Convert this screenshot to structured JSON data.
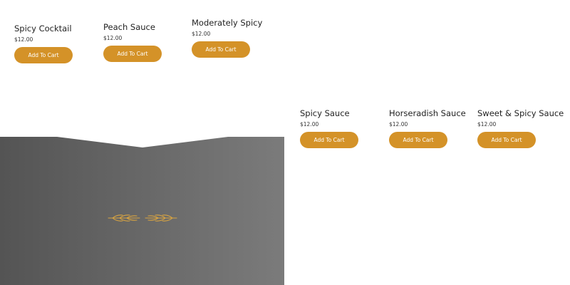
{
  "colors": {
    "accent": "#d49228",
    "banner_dark": "#555555",
    "banner_light": "#7a7a7a",
    "ornament": "#d9a441"
  },
  "products_top": [
    {
      "name": "Spicy Cocktail",
      "price": "$12.00",
      "button": "Add To Cart"
    },
    {
      "name": "Peach Sauce",
      "price": "$12.00",
      "button": "Add To Cart"
    },
    {
      "name": "Moderately Spicy",
      "price": "$12.00",
      "button": "Add To Cart"
    }
  ],
  "products_bottom": [
    {
      "name": "Spicy Sauce",
      "price": "$12.00",
      "button": "Add To Cart"
    },
    {
      "name": "Horseradish Sauce",
      "price": "$12.00",
      "button": "Add To Cart"
    },
    {
      "name": "Sweet & Spicy Sauce",
      "price": "$12.00",
      "button": "Add To Cart"
    }
  ],
  "banner": {
    "ornament_icon": "wheat-branch-ornament-icon"
  }
}
